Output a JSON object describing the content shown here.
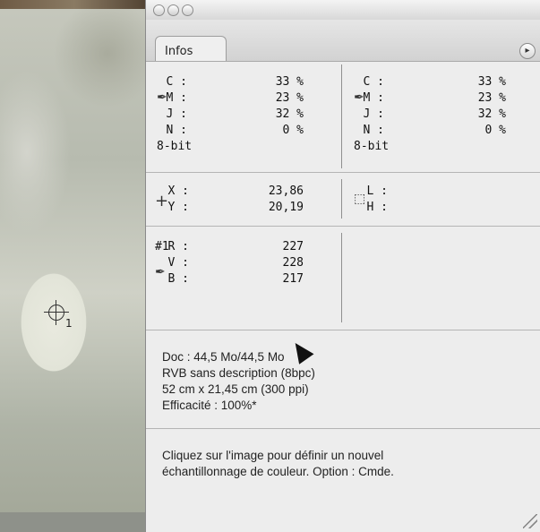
{
  "panel": {
    "tab_label": "Infos",
    "cmyk_left": {
      "rows": [
        {
          "label": "C :",
          "value": "33 %"
        },
        {
          "label": "M :",
          "value": "23 %"
        },
        {
          "label": "J :",
          "value": "32 %"
        },
        {
          "label": "N :",
          "value": "0 %"
        }
      ],
      "bitdepth": "8-bit"
    },
    "cmyk_right": {
      "rows": [
        {
          "label": "C :",
          "value": "33 %"
        },
        {
          "label": "M :",
          "value": "23 %"
        },
        {
          "label": "J :",
          "value": "32 %"
        },
        {
          "label": "N :",
          "value": "0 %"
        }
      ],
      "bitdepth": "8-bit"
    },
    "position": {
      "x_label": "X :",
      "x_value": "23,86",
      "y_label": "Y :",
      "y_value": "20,19"
    },
    "size": {
      "l_label": "L :",
      "h_label": "H :"
    },
    "sampler": {
      "id": "#1",
      "r_label": "R :",
      "r_value": "227",
      "v_label": "V :",
      "v_value": "228",
      "b_label": "B :",
      "b_value": "217"
    },
    "doc_info": [
      "Doc : 44,5 Mo/44,5 Mo",
      "RVB sans description (8bpc)",
      "52 cm x 21,45 cm (300 ppi)",
      "Efficacité : 100%*"
    ],
    "hint": [
      "Cliquez sur l'image pour définir un nouvel",
      "échantillonnage de couleur. Option : Cmde."
    ]
  },
  "canvas": {
    "sampler_number": "1"
  },
  "icons": {
    "menu": "menu-arrow-icon",
    "eyedropper": "eyedropper-icon",
    "crosshair": "crosshair-icon",
    "marquee": "marquee-icon",
    "target": "color-sampler-icon"
  }
}
